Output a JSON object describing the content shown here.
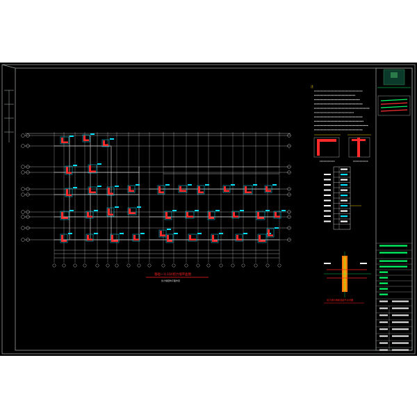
{
  "colors": {
    "background": "#000000",
    "frame": "#9aa0a0",
    "grid": "#e6e6e6",
    "column_fill": "#ff2a2a",
    "column_outline": "#00e0ff",
    "wall": "#d0d0d0",
    "title_red": "#ff2020",
    "title_block_text": "#00ff66",
    "note_text": "#e0e0e0"
  },
  "drawing": {
    "main_title": "基础~-0.100剪力墙平面图",
    "main_subtitle": "剪力墙结构平面布置",
    "detail_title": "剪力墙与墙体连接节点详图",
    "notes_heading": "注"
  },
  "title_block": {
    "company": "",
    "project": "",
    "drawing_name": ""
  }
}
